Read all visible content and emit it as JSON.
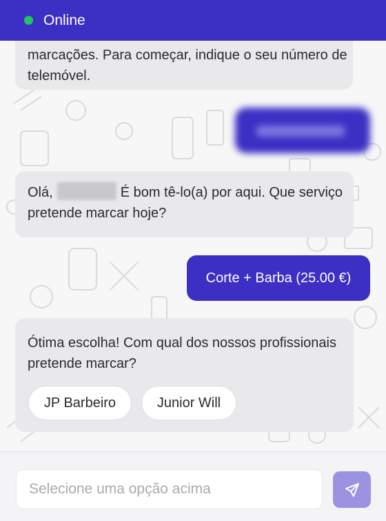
{
  "header": {
    "status": "Online",
    "status_color": "#22c55e",
    "color": "#3b2fc4"
  },
  "messages": {
    "m1_text": "marcações. Para começar, indique o seu número de telemóvel.",
    "m2_prefix": "Olá,",
    "m2_suffix": "É bom tê-lo(a) por aqui. Que serviço pretende marcar hoje?",
    "user_reply": "Corte + Barba (25.00 €)",
    "m3_text": "Ótima escolha! Com qual dos nossos profissionais pretende marcar?",
    "options": [
      "JP Barbeiro",
      "Junior Will"
    ]
  },
  "composer": {
    "placeholder": "Selecione uma opção acima",
    "send_icon": "send-icon"
  }
}
